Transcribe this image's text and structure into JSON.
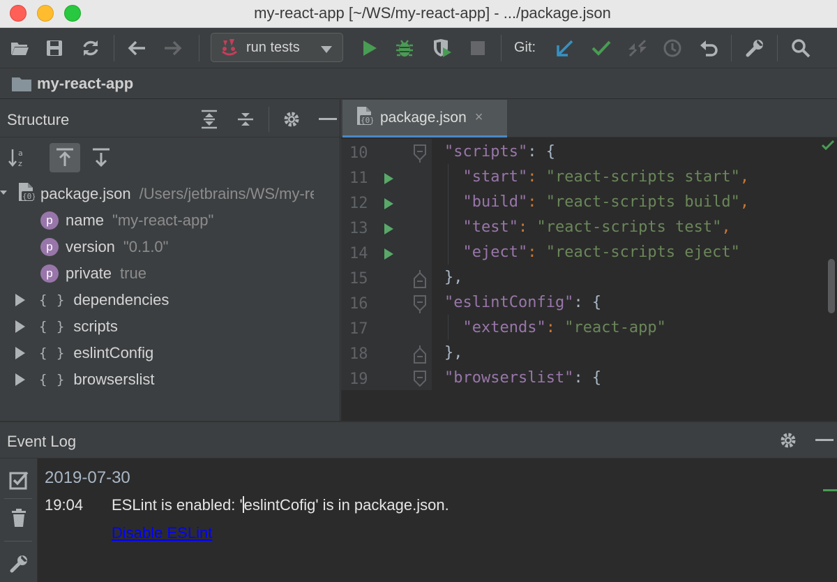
{
  "window": {
    "title": "my-react-app [~/WS/my-react-app] - .../package.json"
  },
  "toolbar": {
    "run_config": "run tests",
    "git_label": "Git:",
    "icons": [
      "open-folder-icon",
      "save-icon",
      "sync-icon",
      "back-icon",
      "forward-icon",
      "run-icon",
      "debug-icon",
      "coverage-icon",
      "stop-icon",
      "git-update-icon",
      "git-commit-icon",
      "git-push-icon",
      "git-history-icon",
      "git-rollback-icon",
      "settings-wrench-icon",
      "search-icon"
    ]
  },
  "navbar": {
    "project": "my-react-app"
  },
  "structure": {
    "title": "Structure",
    "root": {
      "name": "package.json",
      "path": "/Users/jetbrains/WS/my-react-app"
    },
    "properties": [
      {
        "badge": "p",
        "name": "name",
        "value": "\"my-react-app\""
      },
      {
        "badge": "p",
        "name": "version",
        "value": "\"0.1.0\""
      },
      {
        "badge": "p",
        "name": "private",
        "value": "true"
      }
    ],
    "objects": [
      {
        "braces": "{ }",
        "name": "dependencies"
      },
      {
        "braces": "{ }",
        "name": "scripts"
      },
      {
        "braces": "{ }",
        "name": "eslintConfig"
      },
      {
        "braces": "{ }",
        "name": "browserslist"
      }
    ]
  },
  "editor": {
    "tab": "package.json",
    "tab_close": "×",
    "lines": [
      {
        "num": "10",
        "key": "\"scripts\"",
        "rest": ": {"
      },
      {
        "num": "11",
        "key": "\"start\"",
        "sep": ": ",
        "str": "\"react-scripts start\"",
        "end": ","
      },
      {
        "num": "12",
        "key": "\"build\"",
        "sep": ": ",
        "str": "\"react-scripts build\"",
        "end": ","
      },
      {
        "num": "13",
        "key": "\"test\"",
        "sep": ": ",
        "str": "\"react-scripts test\"",
        "end": ","
      },
      {
        "num": "14",
        "key": "\"eject\"",
        "sep": ": ",
        "str": "\"react-scripts eject\"",
        "end": ""
      },
      {
        "num": "15",
        "text": "},"
      },
      {
        "num": "16",
        "key": "\"eslintConfig\"",
        "rest": ": {"
      },
      {
        "num": "17",
        "key": "\"extends\"",
        "sep": ": ",
        "str": "\"react-app\"",
        "end": ""
      },
      {
        "num": "18",
        "text": "},"
      },
      {
        "num": "19",
        "key": "\"browserslist\"",
        "rest": ": {"
      }
    ]
  },
  "event_log": {
    "title": "Event Log",
    "date": "2019-07-30",
    "time": "19:04",
    "message_before": "ESLint is enabled: '",
    "message_after": "eslintCofig' is in package.json.",
    "link": "Disable ESLint"
  },
  "colors": {
    "accent": "#4a88c7",
    "run_green": "#59a869",
    "json_key": "#9876aa",
    "json_string": "#6a8759",
    "link": "#0000ff"
  }
}
